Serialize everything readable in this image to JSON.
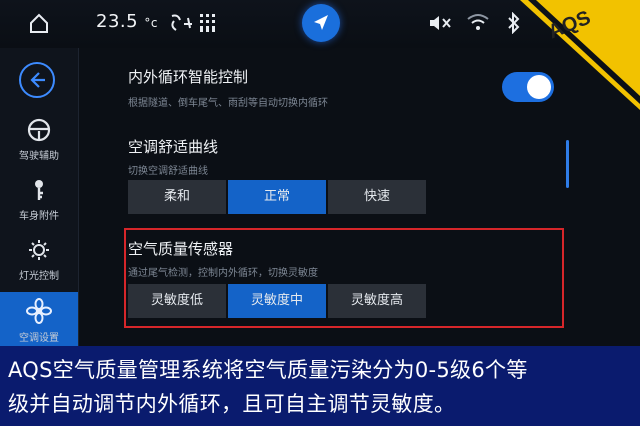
{
  "status_bar": {
    "temperature": "23.5",
    "temperature_unit": "°c",
    "icons": [
      "home-icon",
      "fan-icon",
      "seat-heat-icon",
      "navigation-icon",
      "mute-icon",
      "wifi-icon",
      "bluetooth-icon"
    ]
  },
  "badge": {
    "text": "AQS",
    "color": "#f2c200"
  },
  "sidebar": {
    "items": [
      {
        "label": "驾驶辅助",
        "icon": "steering-wheel-icon"
      },
      {
        "label": "车身附件",
        "icon": "key-icon"
      },
      {
        "label": "灯光控制",
        "icon": "light-icon"
      },
      {
        "label": "空调设置",
        "icon": "fan-icon",
        "active": true
      }
    ]
  },
  "settings": {
    "circulation": {
      "title": "内外循环智能控制",
      "subtitle": "根据隧道、倒车尾气、雨刮等自动切换内循环",
      "enabled": true
    },
    "comfort_curve": {
      "title": "空调舒适曲线",
      "subtitle": "切换空调舒适曲线",
      "options": [
        "柔和",
        "正常",
        "快速"
      ],
      "selected": "正常"
    },
    "air_quality": {
      "title": "空气质量传感器",
      "subtitle": "通过尾气检测，控制内外循环，切换灵敏度",
      "options": [
        "灵敏度低",
        "灵敏度中",
        "灵敏度高"
      ],
      "selected": "灵敏度中"
    }
  },
  "caption": {
    "line1": "AQS空气质量管理系统将空气质量污染分为0-5级6个等",
    "line2": "级并自动调节内外循环，且可自主调节灵敏度。"
  },
  "colors": {
    "accent": "#1463c8",
    "highlight": "#d6262a",
    "caption_bg": "#0a1b6e"
  }
}
